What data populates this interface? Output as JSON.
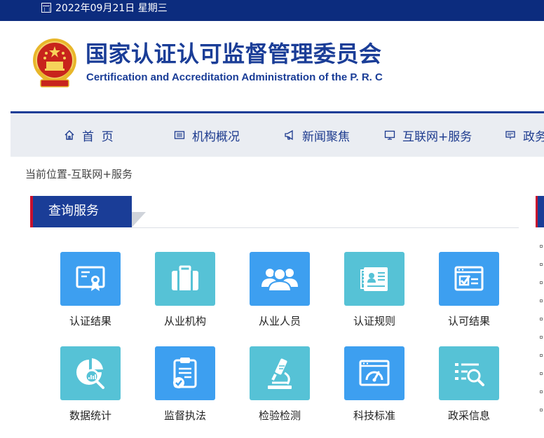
{
  "topbar": {
    "date": "2022年09月21日 星期三",
    "icon": "calendar-icon"
  },
  "header": {
    "title": "国家认证认可监督管理委员会",
    "subtitle": "Certification and Accreditation Administration of the P. R. C",
    "logo": "national-emblem"
  },
  "nav": {
    "items": [
      {
        "label": "首  页",
        "icon": "home-icon"
      },
      {
        "label": "机构概况",
        "icon": "list-icon"
      },
      {
        "label": "新闻聚焦",
        "icon": "megaphone-icon"
      },
      {
        "label": "互联网+服务",
        "icon": "monitor-icon"
      },
      {
        "label": "政务",
        "icon": "document-icon"
      }
    ]
  },
  "breadcrumb": "当前位置-互联网+服务",
  "section": {
    "title": "查询服务"
  },
  "services": [
    {
      "label": "认证结果",
      "icon": "certificate-icon",
      "color": "#3d9ff0"
    },
    {
      "label": "从业机构",
      "icon": "briefcase-icon",
      "color": "#56c2d6"
    },
    {
      "label": "从业人员",
      "icon": "people-icon",
      "color": "#3d9ff0"
    },
    {
      "label": "认证规则",
      "icon": "id-card-icon",
      "color": "#56c2d6"
    },
    {
      "label": "认可结果",
      "icon": "check-list-icon",
      "color": "#3d9ff0"
    },
    {
      "label": "数据统计",
      "icon": "chart-search-icon",
      "color": "#56c2d6"
    },
    {
      "label": "监督执法",
      "icon": "clipboard-check-icon",
      "color": "#3d9ff0"
    },
    {
      "label": "检验检测",
      "icon": "microscope-icon",
      "color": "#56c2d6"
    },
    {
      "label": "科技标准",
      "icon": "gauge-window-icon",
      "color": "#3d9ff0"
    },
    {
      "label": "政采信息",
      "icon": "list-search-icon",
      "color": "#56c2d6"
    }
  ],
  "colors": {
    "brand": "#1a3d97",
    "topbar": "#0c2c7e",
    "accent_red": "#c8102e"
  }
}
